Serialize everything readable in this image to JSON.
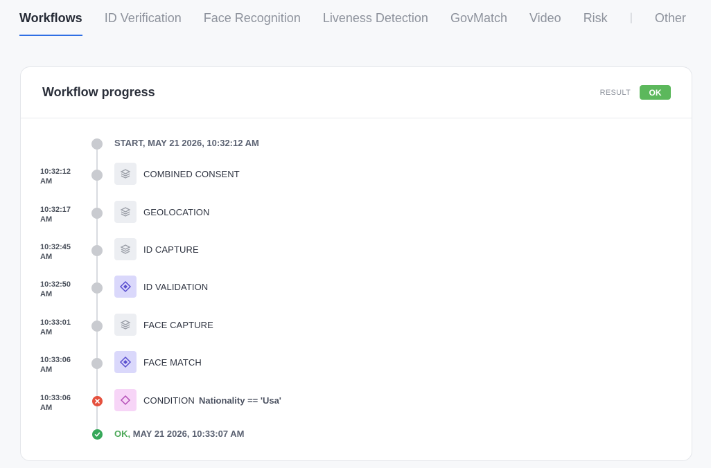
{
  "tabs": [
    {
      "label": "Workflows",
      "active": true
    },
    {
      "label": "ID Verification"
    },
    {
      "label": "Face Recognition"
    },
    {
      "label": "Liveness Detection"
    },
    {
      "label": "GovMatch"
    },
    {
      "label": "Video"
    },
    {
      "label": "Risk"
    },
    {
      "label": "Other"
    }
  ],
  "card": {
    "title": "Workflow progress",
    "result_label": "RESULT",
    "result_value": "OK"
  },
  "timeline": {
    "start": "START, MAY 21 2026, 10:32:12 AM",
    "steps": [
      {
        "time_a": "10:32:12",
        "time_b": "AM",
        "label": "COMBINED CONSENT",
        "icon": "layers-icon"
      },
      {
        "time_a": "10:32:17",
        "time_b": "AM",
        "label": "GEOLOCATION",
        "icon": "layers-icon"
      },
      {
        "time_a": "10:32:45",
        "time_b": "AM",
        "label": "ID CAPTURE",
        "icon": "layers-icon"
      },
      {
        "time_a": "10:32:50",
        "time_b": "AM",
        "label": "ID VALIDATION",
        "icon": "diamond-arrows-icon"
      },
      {
        "time_a": "10:33:01",
        "time_b": "AM",
        "label": "FACE CAPTURE",
        "icon": "layers-icon"
      },
      {
        "time_a": "10:33:06",
        "time_b": "AM",
        "label": "FACE MATCH",
        "icon": "diamond-arrows-icon"
      },
      {
        "time_a": "10:33:06",
        "time_b": "AM",
        "label": "CONDITION",
        "detail": "Nationality == 'Usa'",
        "icon": "diamond-icon"
      }
    ],
    "end_status": "OK,",
    "end_time": "MAY 21 2026, 10:33:07 AM"
  },
  "colors": {
    "accent": "#2f6fe4",
    "ok": "#5cb85c",
    "error": "#e5513e",
    "purple": "#5a4fcf",
    "pink": "#b44fb7"
  }
}
